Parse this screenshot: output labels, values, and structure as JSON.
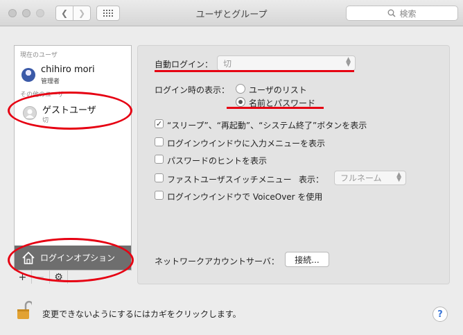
{
  "window": {
    "title": "ユーザとグループ",
    "search_placeholder": "検索"
  },
  "sidebar": {
    "current_users_label": "現在のユーザ",
    "current_user": {
      "name": "chihiro mori",
      "role": "管理者"
    },
    "other_users_label": "その他のユーザ",
    "guest_user": {
      "name": "ゲストユーザ",
      "status": "切"
    },
    "login_options_label": "ログインオプション",
    "add_label": "+",
    "remove_label": "−",
    "gear_label": "⚙"
  },
  "login": {
    "auto_login_label": "自動ログイン：",
    "auto_login_value": "切",
    "display_label": "ログイン時の表示：",
    "radio_options": [
      "ユーザのリスト",
      "名前とパスワード"
    ],
    "radio_selected": 1,
    "checkboxes": [
      {
        "label": "“スリープ”、“再起動”、“システム終了”ボタンを表示",
        "checked": true
      },
      {
        "label": "ログインウインドウに入力メニューを表示",
        "checked": false
      },
      {
        "label": "パスワードのヒントを表示",
        "checked": false
      },
      {
        "label": "ファストユーザスイッチメニュー",
        "checked": false
      },
      {
        "label": "ログインウインドウで VoiceOver を使用",
        "checked": false
      }
    ],
    "fast_switch_display_label": "表示：",
    "fast_switch_display_value": "フルネーム",
    "network_server_label": "ネットワークアカウントサーバ：",
    "join_button": "接続..."
  },
  "footer": {
    "lock_text": "変更できないようにするにはカギをクリックします。",
    "help_label": "?"
  },
  "colors": {
    "annotation_red": "#e60012",
    "selected_row": "#6e6e6e"
  }
}
